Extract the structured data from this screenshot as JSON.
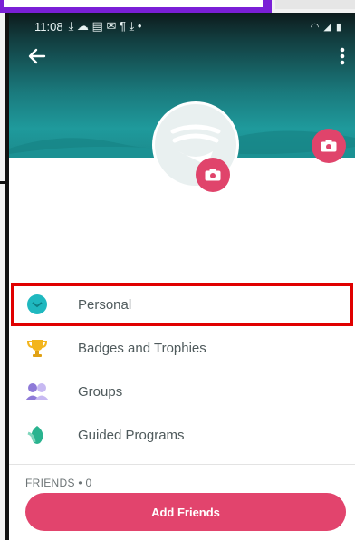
{
  "status_bar": {
    "time": "11:08",
    "left_icons": "⤓ ☁ ▤ ✉ ¶ ⤓ •",
    "right_icons": "◠ ◢ ▮"
  },
  "menu": [
    {
      "label": "Personal",
      "icon": "personal-icon",
      "color": "#1fb8bf",
      "selected": true
    },
    {
      "label": "Badges and Trophies",
      "icon": "trophy-icon",
      "color": "#f3b51c",
      "selected": false
    },
    {
      "label": "Groups",
      "icon": "groups-icon",
      "color": "#8e7ad8",
      "selected": false
    },
    {
      "label": "Guided Programs",
      "icon": "guided-programs-icon",
      "color": "#2ab38f",
      "selected": false
    }
  ],
  "friends": {
    "label": "FRIENDS • 0",
    "button": "Add Friends"
  },
  "colors": {
    "accent": "#e2446d",
    "header": "#1f9a9c",
    "selection_highlight": "#e00000"
  }
}
